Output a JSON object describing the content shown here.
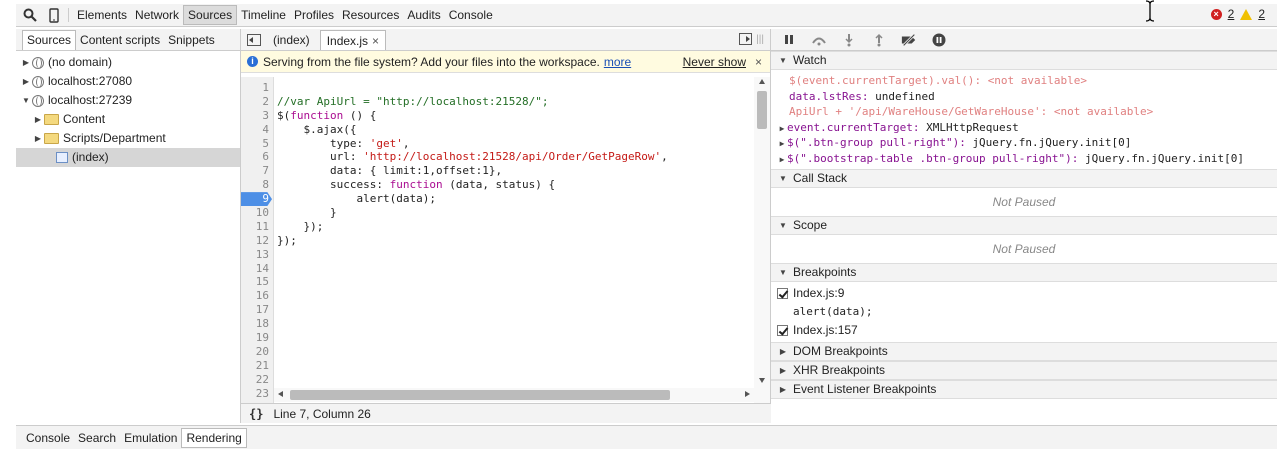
{
  "toolbar": {
    "tabs": [
      "Elements",
      "Network",
      "Sources",
      "Timeline",
      "Profiles",
      "Resources",
      "Audits",
      "Console"
    ],
    "active_tab": "Sources",
    "error_count": "2",
    "warning_count": "2",
    "icons": [
      "search-icon",
      "device-icon"
    ]
  },
  "navigator": {
    "tabs": [
      "Sources",
      "Content scripts",
      "Snippets"
    ],
    "tree": [
      {
        "label": "(no domain)",
        "icon": "globe-icon",
        "indent": 0,
        "expanded": false
      },
      {
        "label": "localhost:27080",
        "icon": "globe-icon",
        "indent": 0,
        "expanded": false
      },
      {
        "label": "localhost:27239",
        "icon": "globe-icon",
        "indent": 0,
        "expanded": true
      },
      {
        "label": "Content",
        "icon": "folder-icon",
        "indent": 1,
        "expanded": false
      },
      {
        "label": "Scripts/Department",
        "icon": "folder-icon",
        "indent": 1,
        "expanded": false
      },
      {
        "label": "(index)",
        "icon": "file-icon",
        "indent": 2,
        "selected": true
      }
    ]
  },
  "editor": {
    "tabs": [
      {
        "label": "(index)",
        "active": false
      },
      {
        "label": "Index.js",
        "active": true,
        "closable": true
      }
    ],
    "infobar": {
      "message": "Serving from the file system? Add your files into the workspace.",
      "link": "more",
      "dismiss": "Never show",
      "close": "×"
    },
    "breakpoint_line": 9,
    "lines": [
      "",
      "//var ApiUrl = \"http://localhost:21528/\";",
      "$(function () {",
      "    $.ajax({",
      "        type: 'get',",
      "        url: 'http://localhost:21528/api/Order/GetPageRow',",
      "        data: { limit:1,offset:1},",
      "        success: function (data, status) {",
      "            alert(data);",
      "        }",
      "    });",
      "});",
      "",
      "",
      "",
      "",
      "",
      "",
      "",
      "",
      "",
      "",
      ""
    ],
    "status": {
      "format_icon": "{}",
      "position": "Line 7, Column 26"
    }
  },
  "debugger": {
    "toolbar_icons": [
      "pause-icon",
      "step-over-icon",
      "step-into-icon",
      "step-out-icon",
      "deactivate-breakpoints-icon",
      "pause-on-exceptions-icon"
    ],
    "watch": {
      "title": "Watch",
      "items": [
        {
          "expr": "$(event.currentTarget).val()",
          "value": "<not available>",
          "available": false
        },
        {
          "expr": "data.lstRes",
          "value": "undefined",
          "available": true
        },
        {
          "expr": "ApiUrl + '/api/WareHouse/GetWareHouse'",
          "value": "<not available>",
          "available": false
        },
        {
          "expr": "event.currentTarget",
          "value": "XMLHttpRequest",
          "available": true,
          "expandable": true
        },
        {
          "expr": "$(\".btn-group pull-right\")",
          "value": "jQuery.fn.jQuery.init[0]",
          "available": true,
          "expandable": true
        },
        {
          "expr": "$(\".bootstrap-table .btn-group pull-right\")",
          "value": "jQuery.fn.jQuery.init[0]",
          "available": true,
          "expandable": true
        }
      ]
    },
    "call_stack": {
      "title": "Call Stack",
      "body": "Not Paused"
    },
    "scope": {
      "title": "Scope",
      "body": "Not Paused"
    },
    "breakpoints": {
      "title": "Breakpoints",
      "items": [
        {
          "label": "Index.js:9",
          "code": "alert(data);"
        },
        {
          "label": "Index.js:157",
          "code": ""
        }
      ]
    },
    "collapsed_panes": [
      "DOM Breakpoints",
      "XHR Breakpoints",
      "Event Listener Breakpoints"
    ]
  },
  "drawer": {
    "tabs": [
      "Console",
      "Search",
      "Emulation",
      "Rendering"
    ],
    "active_tab": "Rendering"
  }
}
